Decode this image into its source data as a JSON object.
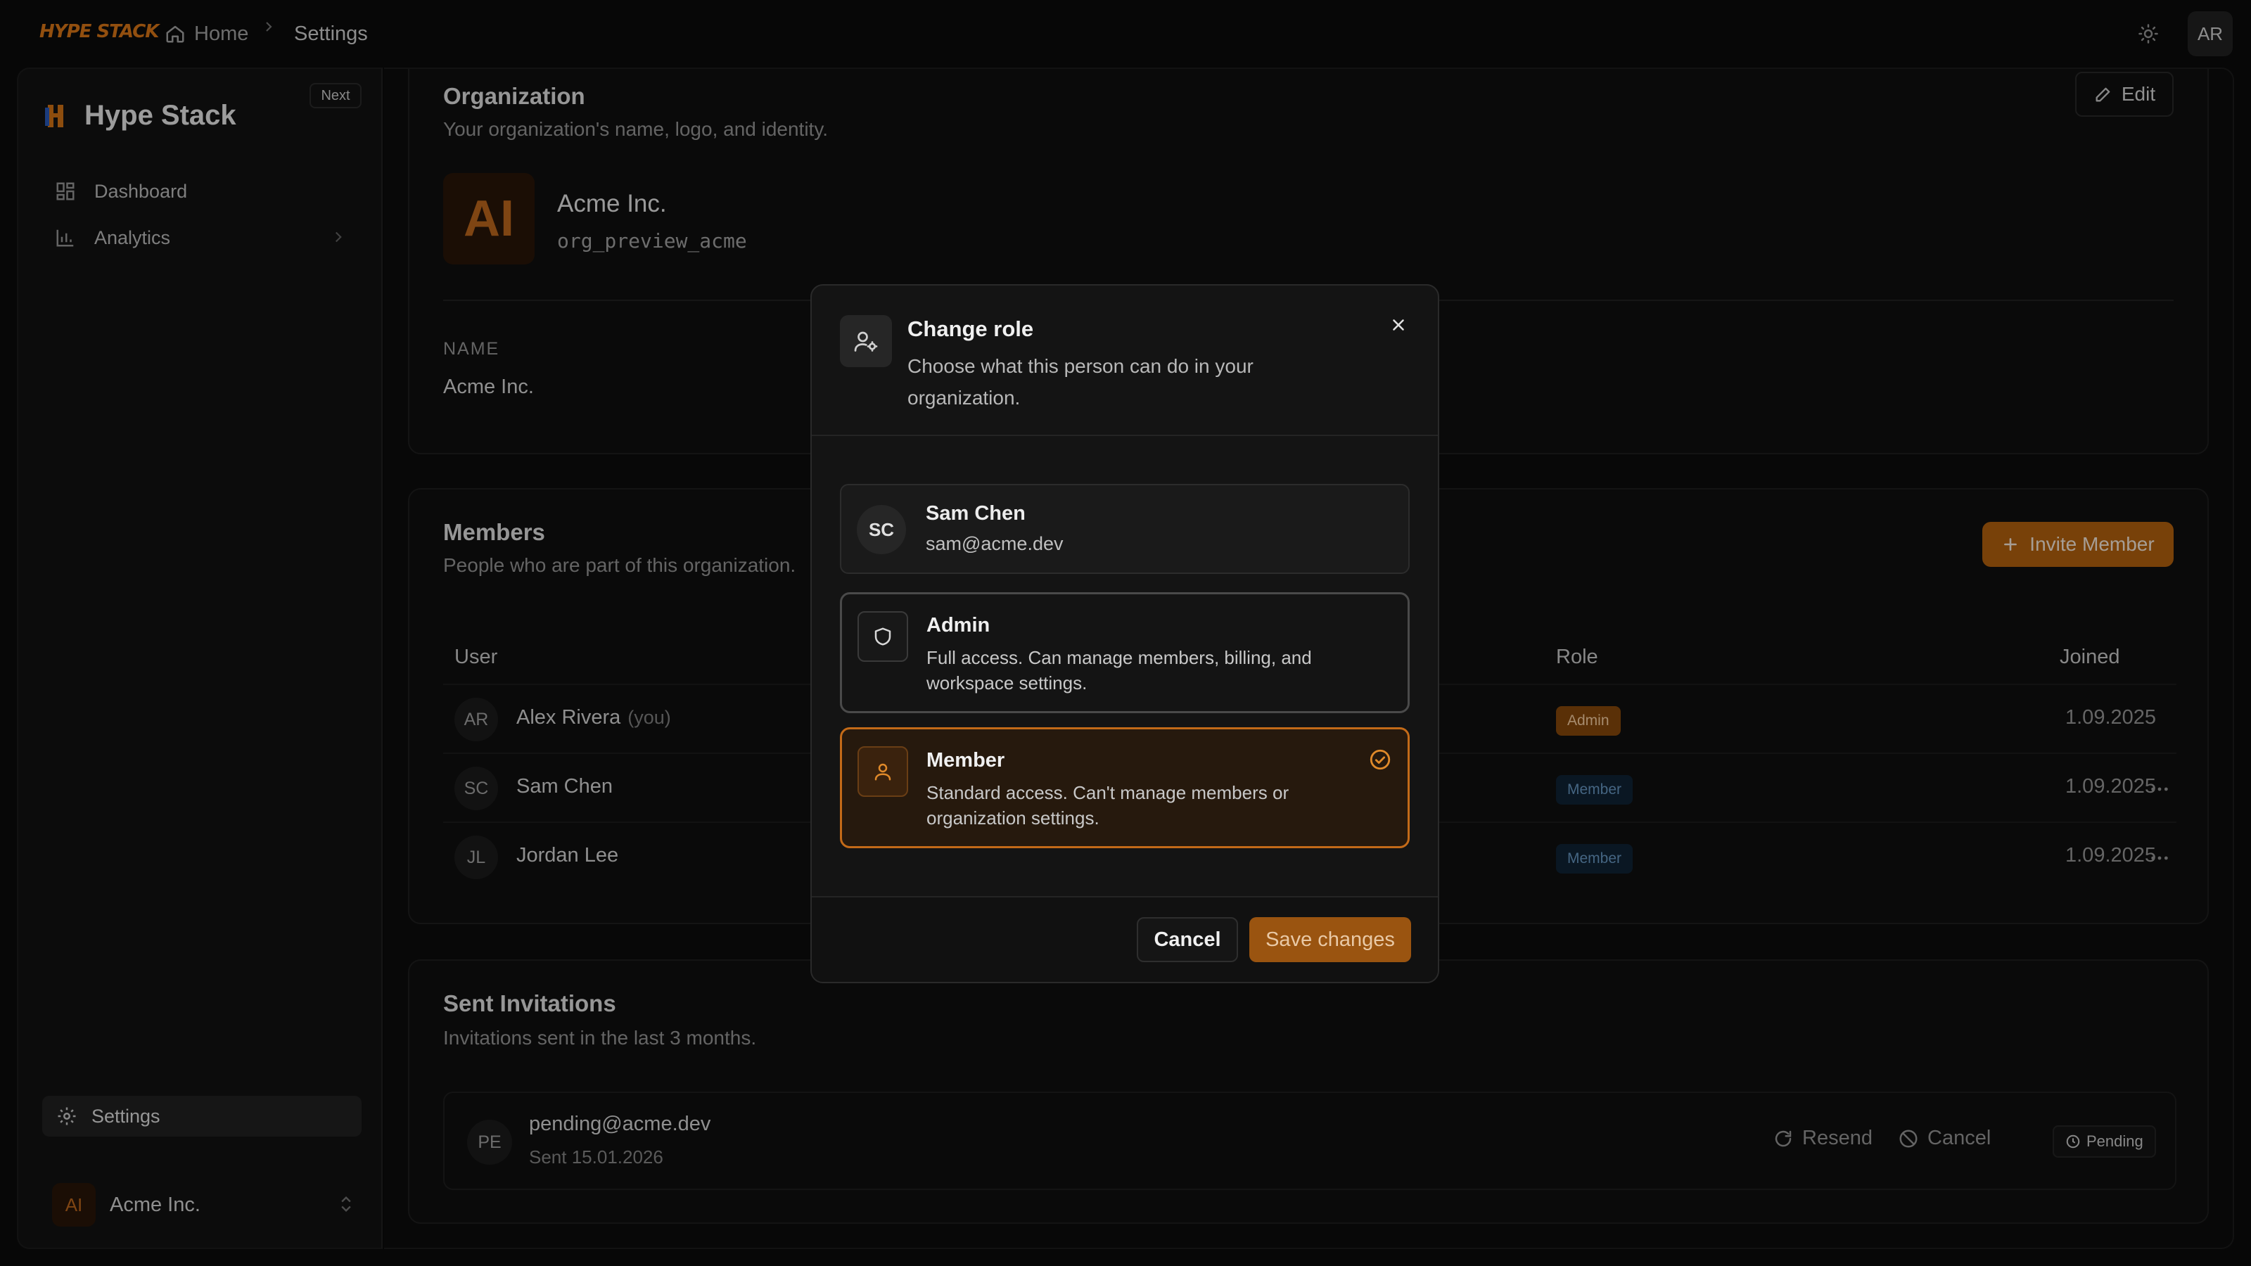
{
  "topbar": {
    "logo_text": "HYPE STACK",
    "breadcrumb": {
      "home": "Home",
      "current": "Settings"
    },
    "theme_icon": "sun-icon",
    "user_initials": "AR"
  },
  "sidebar": {
    "brand": "Hype Stack",
    "badge": "Next",
    "items": [
      {
        "label": "Dashboard",
        "icon": "grid-icon"
      },
      {
        "label": "Analytics",
        "icon": "bar-chart-icon"
      }
    ],
    "settings_label": "Settings",
    "org": {
      "initials": "AI",
      "name": "Acme Inc."
    }
  },
  "organization": {
    "title": "Organization",
    "subtitle": "Your organization's name, logo, and identity.",
    "edit_label": "Edit",
    "logo_initials": "AI",
    "name": "Acme Inc.",
    "slug": "org_preview_acme",
    "field_label": "NAME",
    "field_value": "Acme Inc."
  },
  "members": {
    "title": "Members",
    "subtitle": "People who are part of this organization.",
    "invite_label": "Invite Member",
    "columns": {
      "user": "User",
      "role": "Role",
      "joined": "Joined"
    },
    "rows": [
      {
        "initials": "AR",
        "name": "Alex Rivera",
        "you": "(you)",
        "role": "Admin",
        "joined": "1.09.2025"
      },
      {
        "initials": "SC",
        "name": "Sam Chen",
        "you": "",
        "role": "Member",
        "joined": "1.09.2025"
      },
      {
        "initials": "JL",
        "name": "Jordan Lee",
        "you": "",
        "role": "Member",
        "joined": "1.09.2025"
      }
    ]
  },
  "invitations": {
    "title": "Sent Invitations",
    "subtitle": "Invitations sent in the last 3 months.",
    "item": {
      "initials": "PE",
      "email": "pending@acme.dev",
      "sent": "Sent 15.01.2026",
      "resend_label": "Resend",
      "cancel_label": "Cancel",
      "status": "Pending"
    }
  },
  "modal": {
    "title": "Change role",
    "description": "Choose what this person can do in your organization.",
    "user": {
      "initials": "SC",
      "name": "Sam Chen",
      "email": "sam@acme.dev"
    },
    "options": [
      {
        "title": "Admin",
        "description": "Full access. Can manage members, billing, and workspace settings.",
        "selected": false
      },
      {
        "title": "Member",
        "description": "Standard access. Can't manage members or organization settings.",
        "selected": true
      }
    ],
    "cancel_label": "Cancel",
    "save_label": "Save changes"
  },
  "colors": {
    "accent": "#c36a18",
    "background": "#0b0b0b",
    "member_badge": "#6a9cc8"
  }
}
